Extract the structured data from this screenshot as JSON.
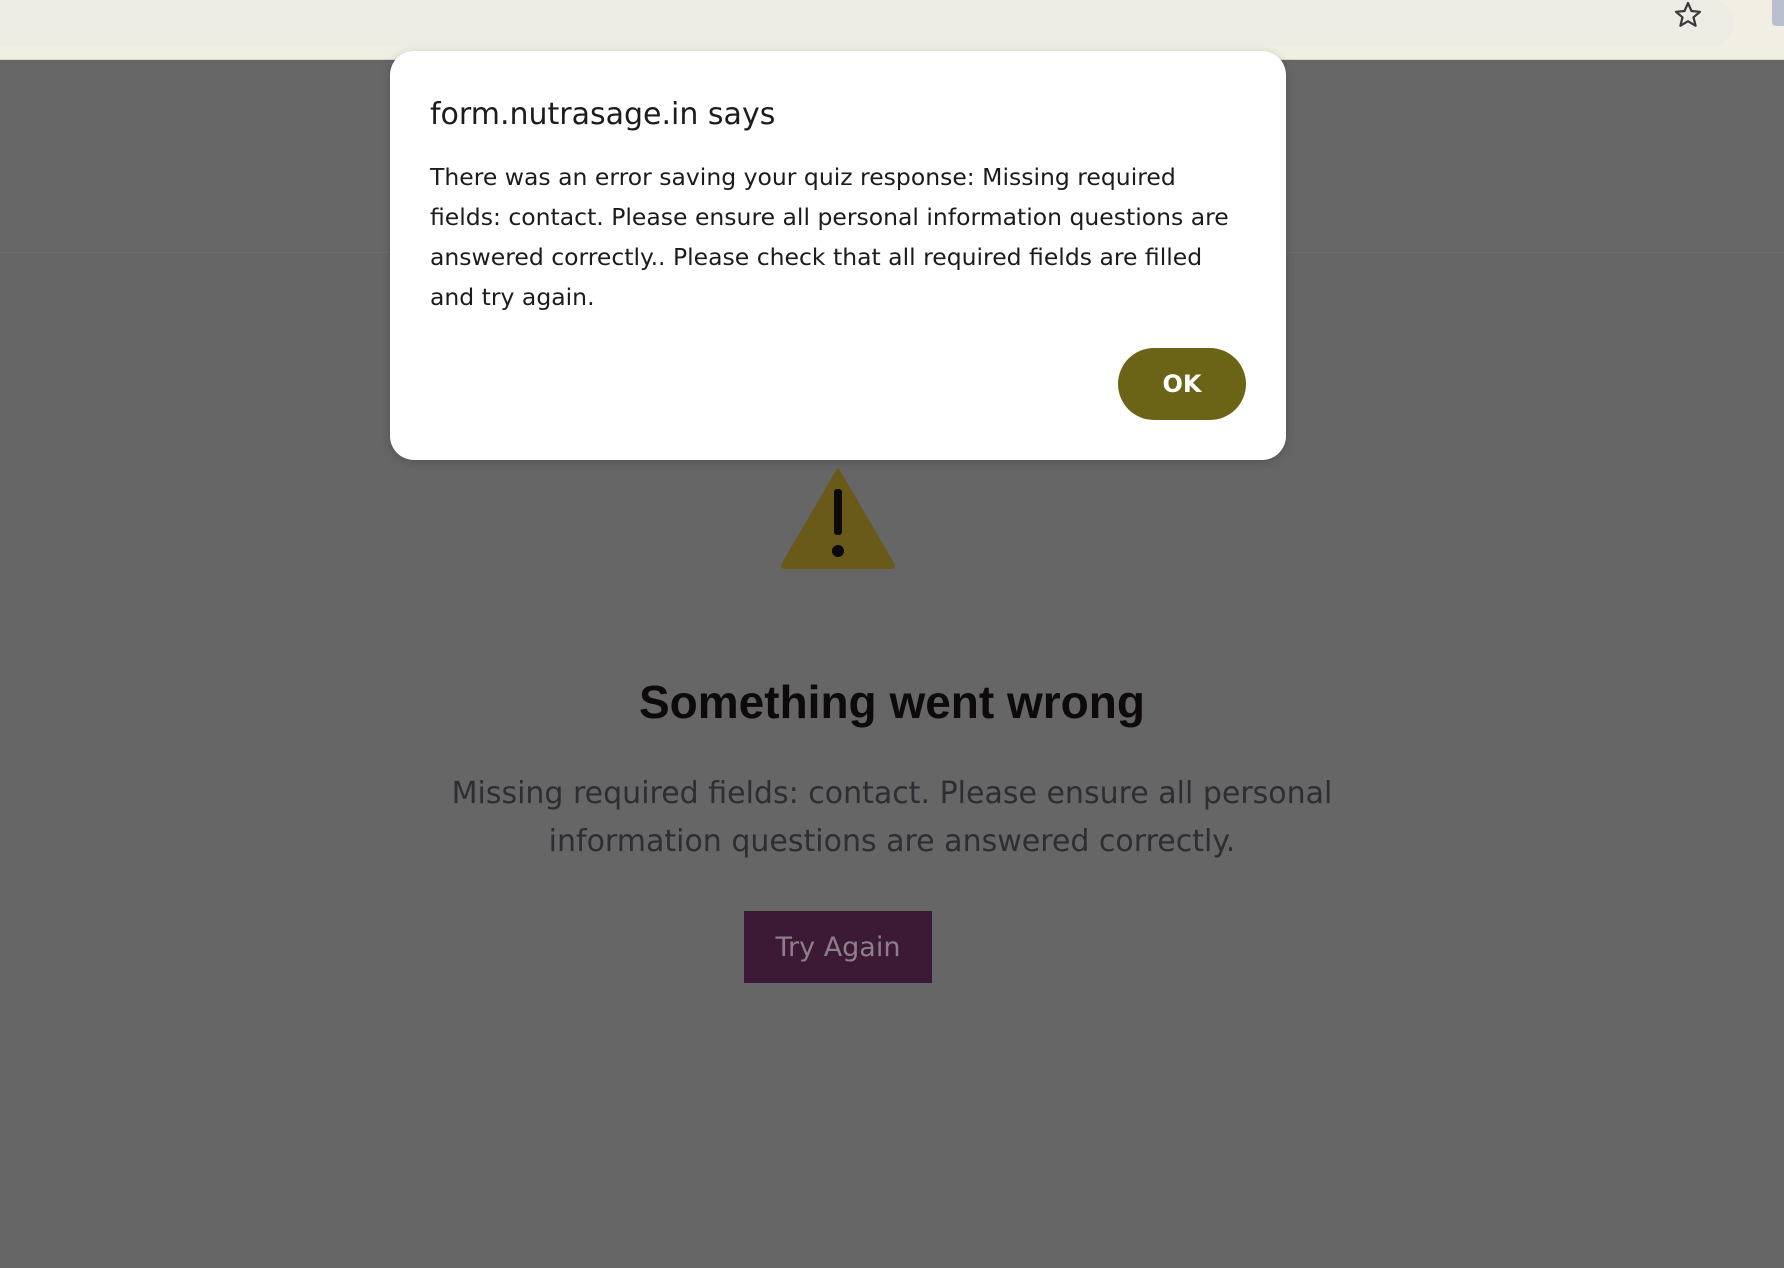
{
  "browser": {
    "bookmark_icon": "star-icon"
  },
  "dialog": {
    "title": "form.nutrasage.in says",
    "message": "There was an error saving your quiz response: Missing required fields: contact. Please ensure all personal information questions are answered correctly.. Please check that all required fields are filled and try again.",
    "ok_label": "OK",
    "ok_color": "#6b6417"
  },
  "page": {
    "icon": "warning-icon",
    "icon_color": "#6a5a1a",
    "title": "Something went wrong",
    "message": "Missing required fields: contact. Please ensure all personal information questions are answered correctly.",
    "button_label": "Try Again",
    "button_color": "#3c1a35"
  }
}
